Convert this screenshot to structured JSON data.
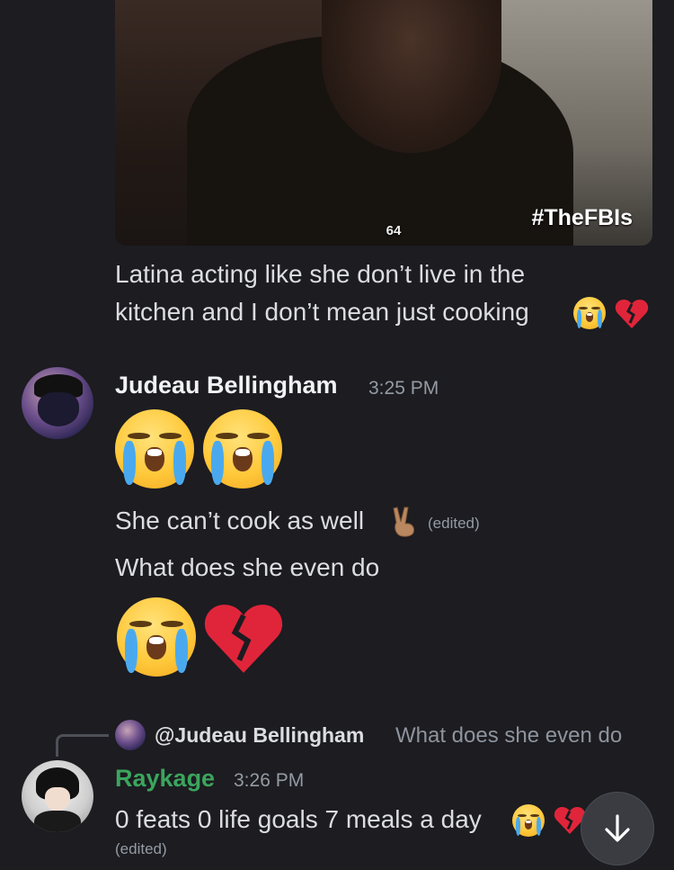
{
  "embed": {
    "hashtag": "#TheFBIs",
    "logo": "64"
  },
  "messages": {
    "caption_line1": "Latina acting like she don’t live in the",
    "caption_line2": "kitchen and I don’t mean just cooking",
    "judeau": {
      "author": "Judeau Bellingham",
      "time": "3:25 PM",
      "line1": "She can’t cook  as well",
      "line1_edited": "(edited)",
      "line2": "What does she even do"
    },
    "raykage": {
      "reply_author": "@Judeau Bellingham",
      "reply_text": "What does she even do",
      "author": "Raykage",
      "author_color": "#3ba55d",
      "time": "3:26 PM",
      "text": "0 feats 0 life goals 7 meals a day",
      "edited": "(edited)"
    }
  },
  "icons": {
    "sob": "loudly-crying-face-emoji",
    "broken_heart": "broken-heart-emoji",
    "peace": "victory-hand-emoji",
    "jump": "arrow-down-icon"
  }
}
